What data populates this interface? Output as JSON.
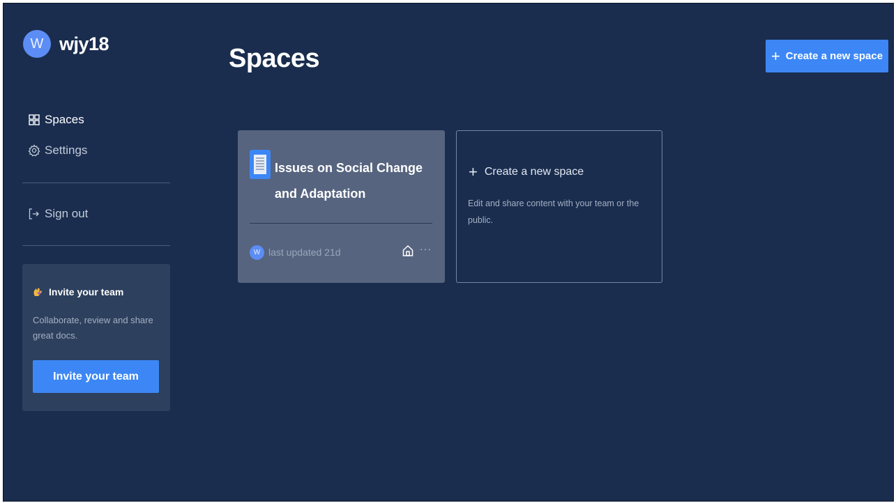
{
  "user": {
    "avatar_letter": "W",
    "name": "wjy18"
  },
  "sidebar": {
    "items": [
      {
        "label": "Spaces",
        "icon": "grid-icon"
      },
      {
        "label": "Settings",
        "icon": "gear-icon"
      }
    ],
    "sign_out": {
      "label": "Sign out",
      "icon": "sign-out-icon"
    }
  },
  "invite": {
    "title": "Invite your team",
    "description": "Collaborate, review and share great docs.",
    "button_label": "Invite your team"
  },
  "main": {
    "title": "Spaces",
    "create_button_label": "Create a new space",
    "spaces": [
      {
        "title": "Issues on Social Change and Adaptation",
        "avatar_letter": "W",
        "updated": "last updated 21d",
        "more": "···"
      }
    ],
    "new_space_card": {
      "title": "Create a new space",
      "description": "Edit and share content with your team or the public."
    }
  },
  "colors": {
    "background": "#1a2d4f",
    "accent": "#3c87f5",
    "card": "#56647f",
    "invite_card": "#2d405e"
  }
}
